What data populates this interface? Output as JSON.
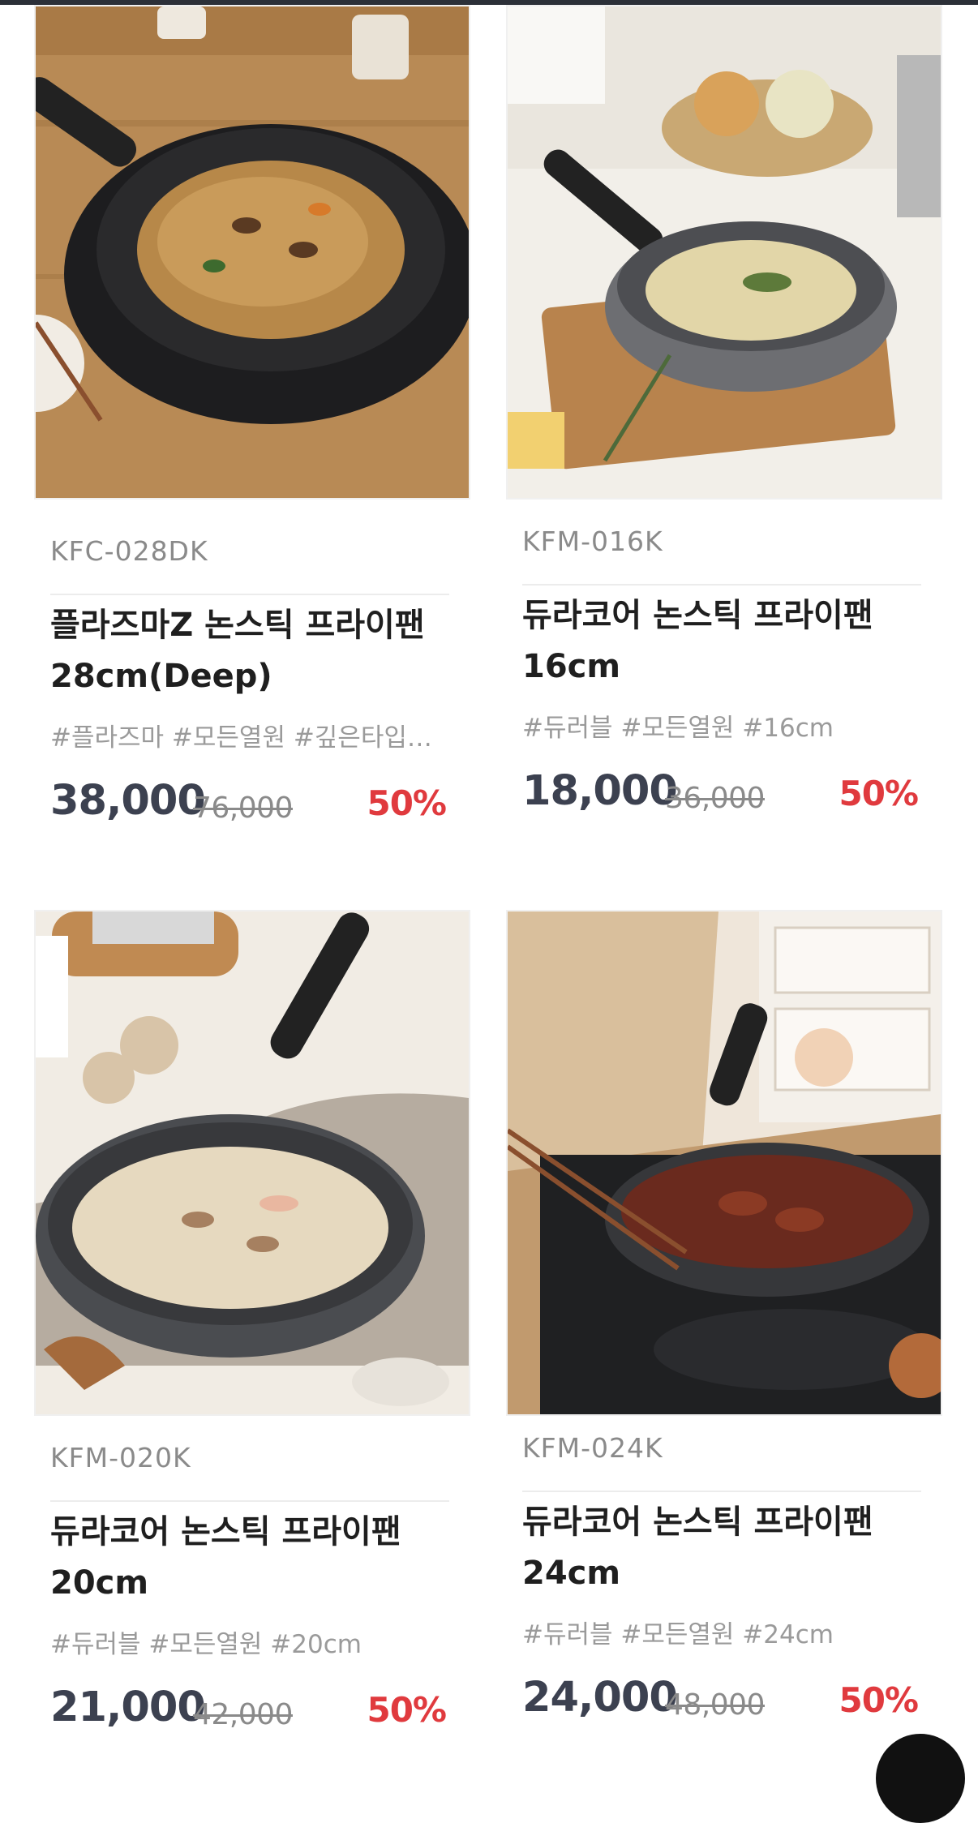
{
  "products": [
    {
      "model": "KFC-028DK",
      "name_line1": "플라즈마Z 논스틱 프라이팬",
      "name_line2": "28cm(Deep)",
      "tags": "#플라즈마 #모든열원 #깊은타입…",
      "price": "38,000",
      "original_price": "76,000",
      "discount": "50%"
    },
    {
      "model": "KFM-016K",
      "name_line1": "듀라코어 논스틱 프라이팬",
      "name_line2": "16cm",
      "tags": "#듀러블 #모든열원 #16cm",
      "price": "18,000",
      "original_price": "36,000",
      "discount": "50%"
    },
    {
      "model": "KFM-020K",
      "name_line1": "듀라코어 논스틱 프라이팬",
      "name_line2": "20cm",
      "tags": "#듀러블 #모든열원 #20cm",
      "price": "21,000",
      "original_price": "42,000",
      "discount": "50%"
    },
    {
      "model": "KFM-024K",
      "name_line1": "듀라코어 논스틱 프라이팬",
      "name_line2": "24cm",
      "tags": "#듀러블 #모든열원 #24cm",
      "price": "24,000",
      "original_price": "48,000",
      "discount": "50%"
    }
  ],
  "colors": {
    "discount": "#e03a3e",
    "price": "#3c4150",
    "model": "#8a8a8a"
  }
}
